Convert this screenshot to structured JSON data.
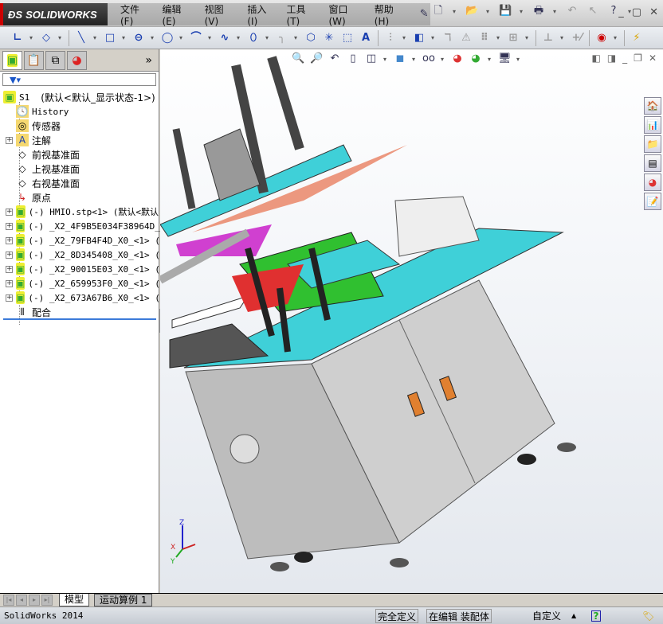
{
  "app": {
    "brand": "SOLIDWORKS",
    "version_text": "SolidWorks 2014"
  },
  "menu": [
    "文件(F)",
    "编辑(E)",
    "视图(V)",
    "插入(I)",
    "工具(T)",
    "窗口(W)",
    "帮助(H)"
  ],
  "quick_access": [
    {
      "icon": "pin-icon"
    },
    {
      "icon": "new-document-icon"
    },
    {
      "icon": "open-icon"
    },
    {
      "icon": "save-icon"
    },
    {
      "icon": "print-icon"
    },
    {
      "icon": "undo-icon"
    },
    {
      "icon": "select-icon"
    },
    {
      "icon": "help-icon"
    }
  ],
  "toolbar": [
    "sketch",
    "smart-dimension",
    "line",
    "rectangle",
    "slot",
    "circle",
    "arc",
    "spline",
    "ellipse",
    "fillet",
    "polygon",
    "point",
    "construction",
    "text",
    "mirror",
    "offset",
    "trim",
    "convert",
    "linear-pattern",
    "move",
    "display-relations",
    "repair",
    "rapid-sketch",
    "instant3d"
  ],
  "panel": {
    "tabs": [
      "feature-manager",
      "property-manager",
      "configuration-manager",
      "display-manager"
    ],
    "expand": "»"
  },
  "tree": {
    "root": {
      "name": "S1",
      "config": "(默认<默认_显示状态-1>)"
    },
    "items": [
      {
        "label": "History",
        "icon": "history-icon",
        "expandable": false,
        "mono": true
      },
      {
        "label": "传感器",
        "icon": "sensor-icon",
        "expandable": false
      },
      {
        "label": "注解",
        "icon": "annotation-icon",
        "expandable": true
      },
      {
        "label": "前视基准面",
        "icon": "plane-icon",
        "expandable": false
      },
      {
        "label": "上视基准面",
        "icon": "plane-icon",
        "expandable": false
      },
      {
        "label": "右视基准面",
        "icon": "plane-icon",
        "expandable": false
      },
      {
        "label": "原点",
        "icon": "origin-icon",
        "expandable": false
      },
      {
        "label": "(-) HMIO.stp<1> (默认<默认",
        "icon": "assembly-icon",
        "expandable": true,
        "mono": true
      },
      {
        "label": "(-) _X2_4F9B5E034F38964D_X",
        "icon": "assembly-icon",
        "expandable": true,
        "mono": true
      },
      {
        "label": "(-) _X2_79FB4F4D_X0_<1> (",
        "icon": "assembly-icon",
        "expandable": true,
        "mono": true
      },
      {
        "label": "(-) _X2_8D345408_X0_<1> (",
        "icon": "assembly-icon",
        "expandable": true,
        "mono": true
      },
      {
        "label": "(-) _X2_90015E03_X0_<1> (",
        "icon": "assembly-icon",
        "expandable": true,
        "mono": true
      },
      {
        "label": "(-) _X2_659953F0_X0_<1> (",
        "icon": "assembly-icon",
        "expandable": true,
        "mono": true
      },
      {
        "label": "(-) _X2_673A67B6_X0_<1> (",
        "icon": "assembly-icon",
        "expandable": true,
        "mono": true
      },
      {
        "label": "配合",
        "icon": "mates-icon",
        "expandable": false
      }
    ]
  },
  "bottom_tabs": [
    "模型",
    "运动算例 1"
  ],
  "status": {
    "left": "SolidWorks 2014",
    "defined": "完全定义",
    "editing": "在编辑 装配体",
    "units": "自定义"
  },
  "axes": {
    "z": "Z",
    "x": "X",
    "y": "Y"
  },
  "colors": {
    "cyan_plate": "#3fd0d8",
    "cabinet": "#c8c8c8",
    "magenta": "#d040d0",
    "highlight": "#3c7bd9"
  }
}
